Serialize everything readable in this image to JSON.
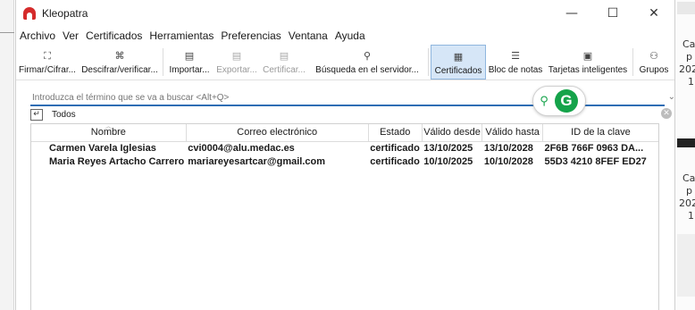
{
  "window": {
    "title": "Kleopatra",
    "minimize": "—",
    "maximize": "☐",
    "close": "✕"
  },
  "menubar": [
    "Archivo",
    "Ver",
    "Certificados",
    "Herramientas",
    "Preferencias",
    "Ventana",
    "Ayuda"
  ],
  "toolbar": [
    {
      "label": "Firmar/Cifrar...",
      "icon": "sign-encrypt-icon",
      "glyph": "⛶",
      "state": "normal"
    },
    {
      "label": "Descifrar/verificar...",
      "icon": "decrypt-icon",
      "glyph": "⌘",
      "state": "normal"
    },
    {
      "label": "Importar...",
      "icon": "import-icon",
      "glyph": "▤",
      "state": "normal"
    },
    {
      "label": "Exportar...",
      "icon": "export-icon",
      "glyph": "▤",
      "state": "disabled"
    },
    {
      "label": "Certificar...",
      "icon": "certify-icon",
      "glyph": "▤",
      "state": "disabled"
    },
    {
      "label": "Búsqueda en el servidor...",
      "icon": "search-icon",
      "glyph": "⚲",
      "state": "normal"
    },
    {
      "label": "Certificados",
      "icon": "certificates-icon",
      "glyph": "▦",
      "state": "active"
    },
    {
      "label": "Bloc de notas",
      "icon": "notepad-icon",
      "glyph": "☰",
      "state": "normal"
    },
    {
      "label": "Tarjetas inteligentes",
      "icon": "smartcard-icon",
      "glyph": "▣",
      "state": "normal"
    },
    {
      "label": "Grupos",
      "icon": "groups-icon",
      "glyph": "⚇",
      "state": "normal"
    }
  ],
  "search": {
    "placeholder": "Introduzca el término que se va a buscar <Alt+Q>",
    "value": ""
  },
  "tabs": {
    "active": "Todos"
  },
  "table": {
    "headers": [
      "Nombre",
      "Correo electrónico",
      "Estado",
      "Válido desde",
      "Válido hasta",
      "ID de la clave"
    ],
    "rows": [
      [
        "Carmen Varela Iglesias",
        "cvi0004@alu.medac.es",
        "certificado",
        "13/10/2025",
        "13/10/2028",
        "2F6B 766F 0963 DA..."
      ],
      [
        "Maria Reyes Artacho Carrero",
        "mariareyesartcar@gmail.com",
        "certificado",
        "10/10/2025",
        "10/10/2028",
        "55D3 4210 8FEF ED27"
      ]
    ]
  },
  "background": {
    "snippets": [
      "Ca",
      "p",
      "202",
      "1",
      "Ca",
      "p",
      "202",
      "1"
    ]
  },
  "colors": {
    "accent": "#2e6db4",
    "active_bg": "#d6e6f7",
    "grammarly": "#15a34a",
    "app_red": "#d52b2b"
  }
}
